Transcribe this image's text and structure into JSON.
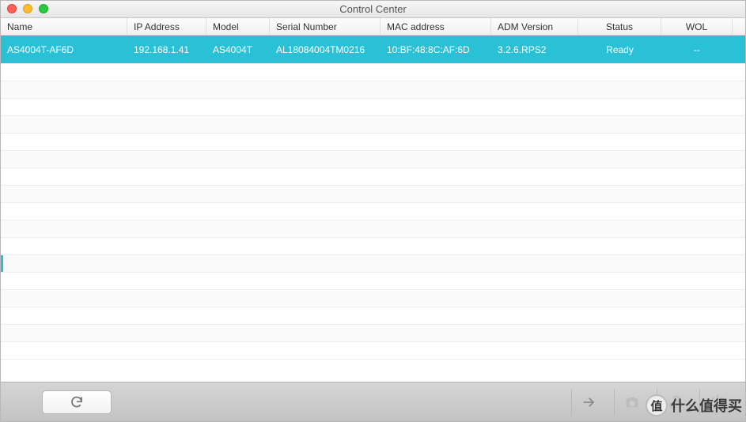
{
  "window": {
    "title": "Control Center"
  },
  "columns": {
    "name": "Name",
    "ip": "IP Address",
    "model": "Model",
    "serial": "Serial Number",
    "mac": "MAC address",
    "adm": "ADM Version",
    "status": "Status",
    "wol": "WOL"
  },
  "rows": [
    {
      "name": "AS4004T-AF6D",
      "ip": "192.168.1.41",
      "model": "AS4004T",
      "serial": "AL18084004TM0216",
      "mac": "10:BF:48:8C:AF:6D",
      "adm": "3.2.6.RPS2",
      "status": "Ready",
      "wol": "--"
    }
  ],
  "icons": {
    "refresh": "refresh-icon",
    "arrow": "arrow-right-icon",
    "camera": "camera-icon",
    "link": "link-icon",
    "power": "power-icon"
  },
  "watermark": {
    "badge": "值",
    "text": "什么值得买"
  }
}
